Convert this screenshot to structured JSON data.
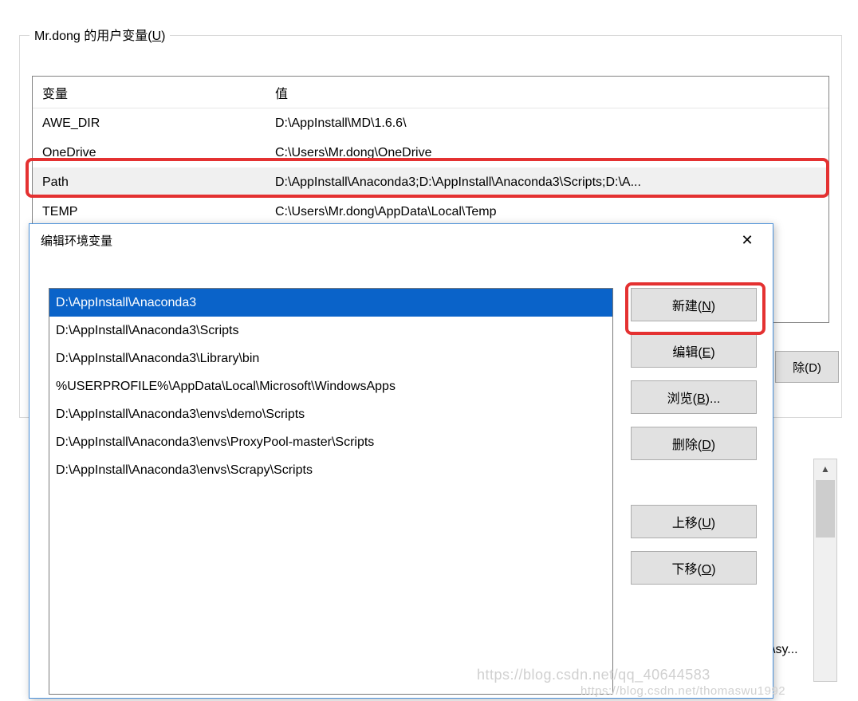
{
  "groupbox": {
    "title_prefix": "Mr.dong 的用户变量(",
    "title_underline": "U",
    "title_suffix": ")"
  },
  "userVars": {
    "header_name": "变量",
    "header_value": "值",
    "rows": [
      {
        "name": "AWE_DIR",
        "value": "D:\\AppInstall\\MD\\1.6.6\\",
        "selected": false
      },
      {
        "name": "OneDrive",
        "value": "C:\\Users\\Mr.dong\\OneDrive",
        "selected": false
      },
      {
        "name": "Path",
        "value": "D:\\AppInstall\\Anaconda3;D:\\AppInstall\\Anaconda3\\Scripts;D:\\A...",
        "selected": true
      },
      {
        "name": "TEMP",
        "value": "C:\\Users\\Mr.dong\\AppData\\Local\\Temp",
        "selected": false
      }
    ]
  },
  "bg_btn_delete": "除(D)",
  "bg_sy_text": "\\sy...",
  "dialog": {
    "title": "编辑环境变量",
    "close_glyph": "✕",
    "paths": [
      {
        "text": "D:\\AppInstall\\Anaconda3",
        "selected": true
      },
      {
        "text": "D:\\AppInstall\\Anaconda3\\Scripts",
        "selected": false
      },
      {
        "text": "D:\\AppInstall\\Anaconda3\\Library\\bin",
        "selected": false
      },
      {
        "text": "%USERPROFILE%\\AppData\\Local\\Microsoft\\WindowsApps",
        "selected": false
      },
      {
        "text": "D:\\AppInstall\\Anaconda3\\envs\\demo\\Scripts",
        "selected": false
      },
      {
        "text": "D:\\AppInstall\\Anaconda3\\envs\\ProxyPool-master\\Scripts",
        "selected": false
      },
      {
        "text": "D:\\AppInstall\\Anaconda3\\envs\\Scrapy\\Scripts",
        "selected": false
      }
    ],
    "buttons": {
      "new": {
        "pre": "新建(",
        "u": "N",
        "post": ")"
      },
      "edit": {
        "pre": "编辑(",
        "u": "E",
        "post": ")"
      },
      "browse": {
        "pre": "浏览(",
        "u": "B",
        "post": ")..."
      },
      "delete": {
        "pre": "删除(",
        "u": "D",
        "post": ")"
      },
      "up": {
        "pre": "上移(",
        "u": "U",
        "post": ")"
      },
      "down": {
        "pre": "下移(",
        "u": "O",
        "post": ")"
      }
    }
  },
  "watermark1": "https://blog.csdn.net/qq_40644583",
  "watermark2": "https://blog.csdn.net/thomaswu1992"
}
